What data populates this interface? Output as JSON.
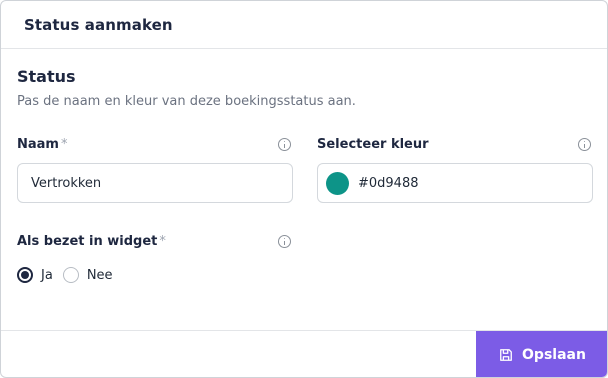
{
  "header": {
    "title": "Status aanmaken"
  },
  "section": {
    "title": "Status",
    "description": "Pas de naam en kleur van deze boekingsstatus aan."
  },
  "fields": {
    "name": {
      "label": "Naam",
      "required_mark": "*",
      "value": "Vertrokken"
    },
    "color": {
      "label": "Selecteer kleur",
      "value": "#0d9488",
      "swatch_color": "#0d9488"
    },
    "widget": {
      "label": "Als bezet in widget",
      "required_mark": "*",
      "options": [
        {
          "label": "Ja",
          "selected": true
        },
        {
          "label": "Nee",
          "selected": false
        }
      ]
    }
  },
  "footer": {
    "save_label": "Opslaan",
    "save_icon": "save-icon"
  },
  "colors": {
    "accent": "#7c5ce6",
    "text_dark": "#1e2740"
  }
}
